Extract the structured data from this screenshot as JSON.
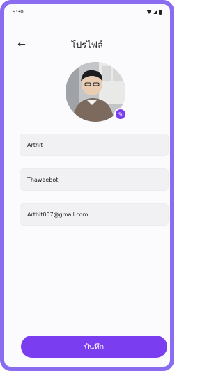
{
  "status_bar": {
    "time": "9:30"
  },
  "app_bar": {
    "back_icon": "arrow-left-icon",
    "title": "โปรไฟล์"
  },
  "profile": {
    "avatar_alt": "",
    "edit_icon": "pencil-icon"
  },
  "form": {
    "first_name": "Arthit",
    "last_name": "Thaweebot",
    "email": "Arthit007@gmail.com"
  },
  "actions": {
    "save_label": "บันทึก"
  },
  "colors": {
    "accent": "#7b3df0",
    "frame": "#8a6cf0",
    "field_bg": "#f1f1f4"
  }
}
